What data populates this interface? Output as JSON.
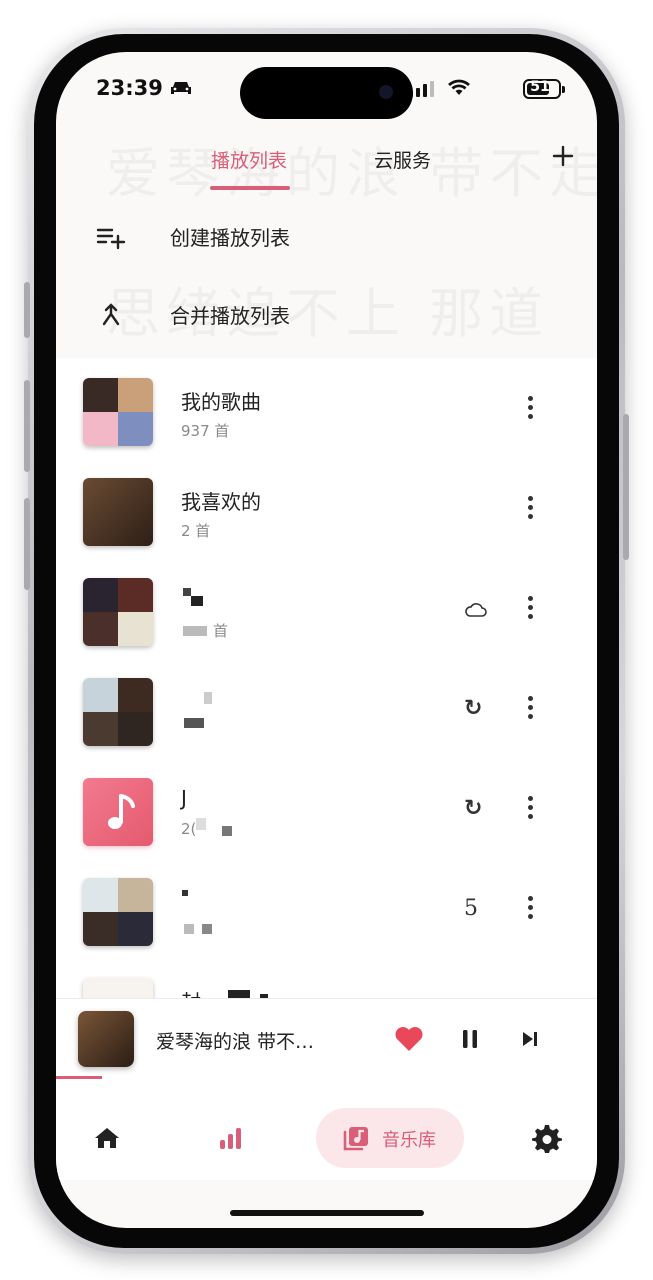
{
  "status_bar": {
    "time": "23:39",
    "battery": "51"
  },
  "background_lyrics": [
    "爱琴海的浪 带不走",
    "思绪追不上 那道"
  ],
  "tabs": [
    {
      "label": "播放列表",
      "active": true
    },
    {
      "label": "云服务",
      "active": false
    }
  ],
  "actions": {
    "create": "创建播放列表",
    "merge": "合并播放列表"
  },
  "playlists": [
    {
      "title": "我的歌曲",
      "subtitle": "937 首",
      "cover": "collage"
    },
    {
      "title": "我喜欢的",
      "subtitle": "2 首",
      "cover": "single"
    },
    {
      "title": "",
      "subtitle": "首",
      "cover": "collage",
      "status_icon": "cloud-icon"
    },
    {
      "title": "",
      "subtitle": "",
      "cover": "collage",
      "status_icon": "sync-icon"
    },
    {
      "title": "J",
      "subtitle": "2(",
      "cover": "music-note",
      "status_icon": "sync-icon"
    },
    {
      "title": "",
      "subtitle": "",
      "cover": "collage",
      "status_icon": "5"
    },
    {
      "title": "封",
      "subtitle": "",
      "cover": "collage"
    }
  ],
  "now_playing": {
    "title": "爱琴海的浪 带不…"
  },
  "bottom_nav": {
    "items": [
      "home-icon",
      "bar-chart-icon",
      "music-library-icon",
      "gear-icon"
    ],
    "active_label": "音乐库"
  },
  "colors": {
    "accent": "#d95f78",
    "accent_bg": "#fbe7ea",
    "heart": "#e8485a"
  }
}
